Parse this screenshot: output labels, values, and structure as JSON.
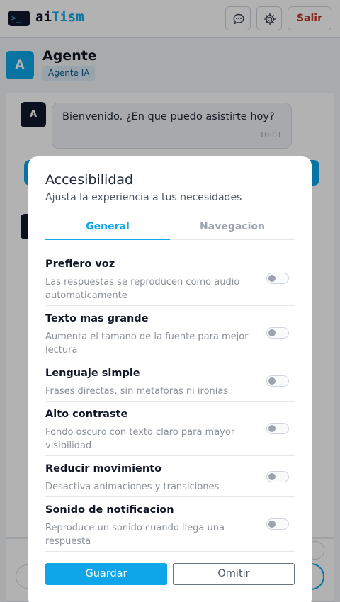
{
  "app": {
    "logo_symbol": ">_",
    "logo_prefix": "ai",
    "logo_accent": "Tism",
    "logout_label": "Salir",
    "accent_color": "#0ea5e9"
  },
  "header_icons": [
    "chat-bubble-icon",
    "gear-icon"
  ],
  "agent": {
    "avatar_letter": "A",
    "name": "Agente",
    "badge": "Agente IA"
  },
  "chat": {
    "messages": [
      {
        "avatar": "A",
        "text": "Bienvenido. ¿En que puedo asistirte hoy?",
        "time": "10:01"
      }
    ]
  },
  "modal": {
    "title": "Accesibilidad",
    "subtitle": "Ajusta la experiencia a tus necesidades",
    "tabs": [
      {
        "label": "General",
        "active": true
      },
      {
        "label": "Navegacion",
        "active": false
      }
    ],
    "settings": [
      {
        "title": "Prefiero voz",
        "desc": "Las respuestas se reproducen como audio automaticamente",
        "enabled": false
      },
      {
        "title": "Texto mas grande",
        "desc": "Aumenta el tamano de la fuente para mejor lectura",
        "enabled": false
      },
      {
        "title": "Lenguaje simple",
        "desc": "Frases directas, sin metaforas ni ironias",
        "enabled": false
      },
      {
        "title": "Alto contraste",
        "desc": "Fondo oscuro con texto claro para mayor visibilidad",
        "enabled": false
      },
      {
        "title": "Reducir movimiento",
        "desc": "Desactiva animaciones y transiciones",
        "enabled": false
      },
      {
        "title": "Sonido de notificacion",
        "desc": "Reproduce un sonido cuando llega una respuesta",
        "enabled": false
      }
    ],
    "save_label": "Guardar",
    "skip_label": "Omitir"
  }
}
